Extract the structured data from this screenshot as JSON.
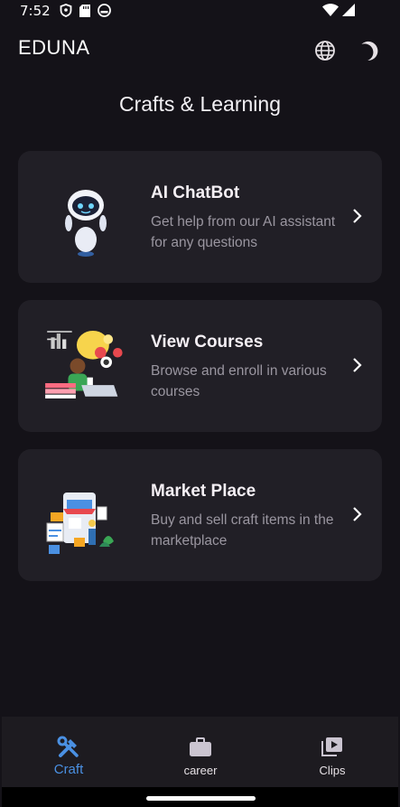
{
  "status_bar": {
    "time": "7:52"
  },
  "app_bar": {
    "title": "EDUNA"
  },
  "page": {
    "title": "Crafts & Learning"
  },
  "cards": [
    {
      "title": "AI ChatBot",
      "description": "Get help from our AI assistant for any questions"
    },
    {
      "title": "View Courses",
      "description": "Browse and enroll in various courses"
    },
    {
      "title": "Market Place",
      "description": "Buy and sell craft items in the marketplace"
    }
  ],
  "bottom_nav": {
    "items": [
      {
        "label": "Craft",
        "icon": "tools-icon",
        "active": true
      },
      {
        "label": "career",
        "icon": "briefcase-icon",
        "active": false
      },
      {
        "label": "Clips",
        "icon": "video-library-icon",
        "active": false
      }
    ]
  },
  "colors": {
    "background": "#141218",
    "card": "#211F26",
    "accent": "#4A90E2",
    "muted_text": "#9A96A0"
  }
}
